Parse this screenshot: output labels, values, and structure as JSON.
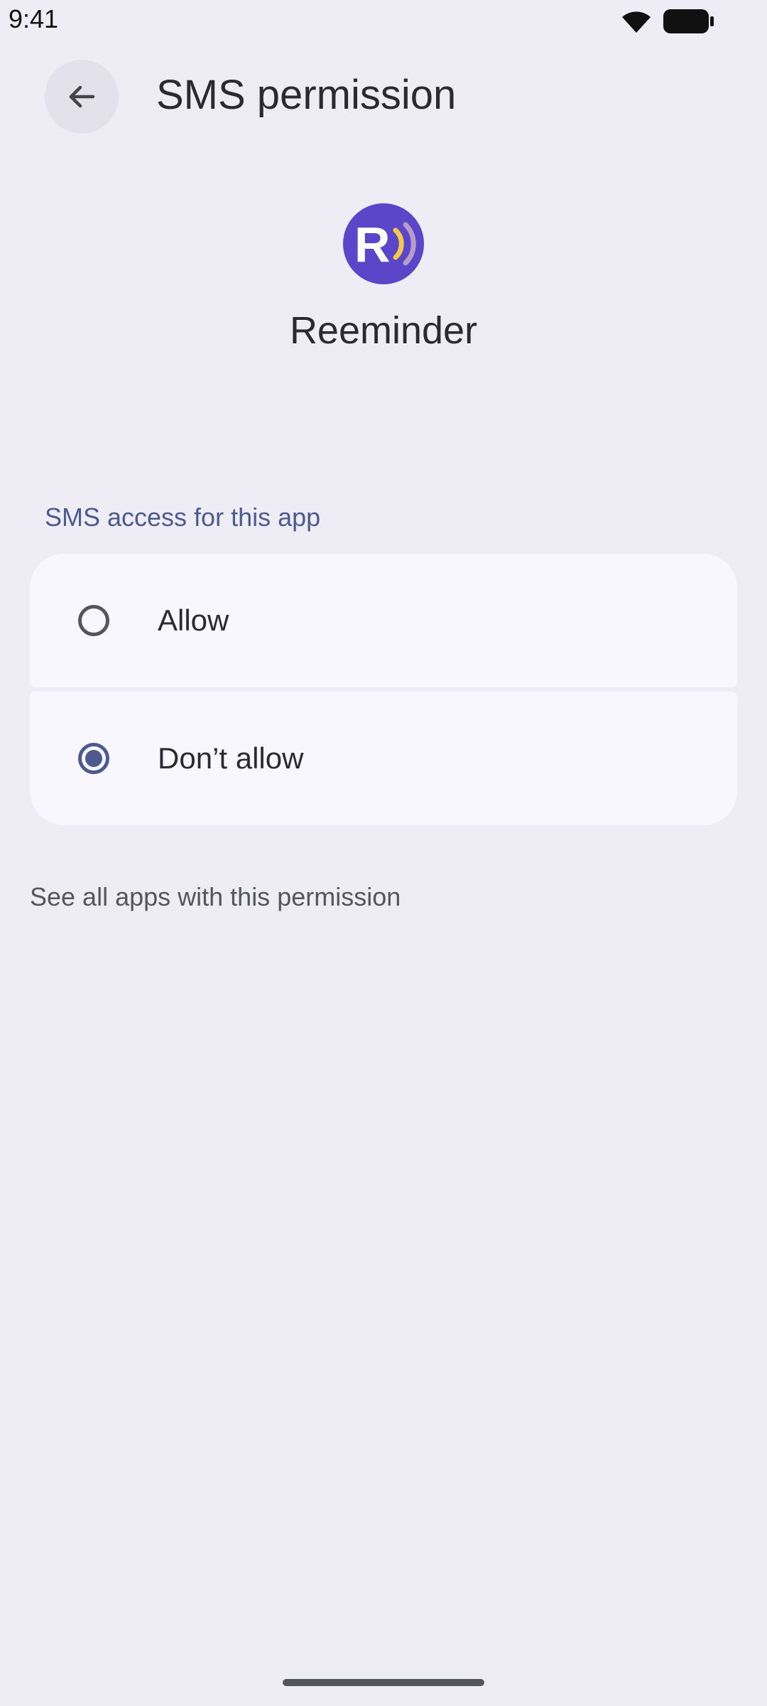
{
  "status_bar": {
    "time": "9:41",
    "icons": [
      "wifi-icon",
      "battery-icon"
    ]
  },
  "app_bar": {
    "back_icon": "arrow-back-icon",
    "title": "SMS permission"
  },
  "app": {
    "name": "Reeminder",
    "icon_letter": "R",
    "icon_color": "#5b45c9",
    "icon_accent_colors": [
      "#f2c94c",
      "#b79cc8"
    ]
  },
  "section": {
    "label": "SMS access for this app"
  },
  "options": [
    {
      "label": "Allow",
      "selected": false
    },
    {
      "label": "Don’t allow",
      "selected": true
    }
  ],
  "footer": {
    "link_text": "See all apps with this permission"
  },
  "colors": {
    "background": "#eeedf6",
    "card": "#f8f7fd",
    "accent": "#4c5a8f"
  }
}
